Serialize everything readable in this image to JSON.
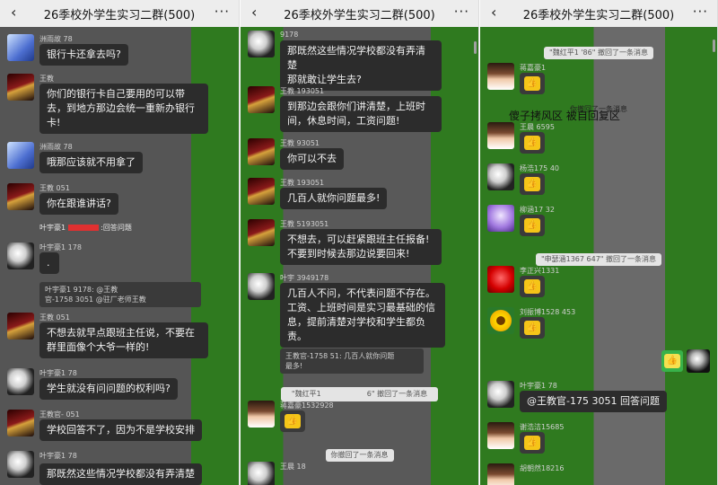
{
  "app": {
    "title": "26季校外学生实习二群(500)",
    "back_glyph": "‹",
    "more_glyph": "···",
    "thumbs_glyph": "👍"
  },
  "panel1": {
    "m1_name": "洲雨故",
    "m1_name_tail": "78",
    "m1_text": "银行卡还拿去吗?",
    "m2_name": "王教",
    "m2_name_tail": "",
    "m2_text_l1": "你们的银行卡自己要用的可以带",
    "m2_text_l2": "去，到地方那边会统一重新办银行",
    "m2_text_l3": "卡!",
    "m3_name": "洲雨故",
    "m3_name_tail": "78",
    "m3_text": "哦那应该就不用拿了",
    "m4_name": "王教",
    "m4_name_tail": "051",
    "m4_text": "你在跟谁讲话?",
    "m5_name": "叶宇豪1",
    "m5_tail": ":回答问题",
    "m6_name": "叶宇豪1",
    "m6_name_tail": "178",
    "m6_text": ".",
    "m6_quote_l1": "叶宇豪1          9178: @王教",
    "m6_quote_l2": "官-1758         3051 @驻厂老师王教",
    "m7_name": "王教",
    "m7_name_tail": "051",
    "m7_text_l1": "不想去就早点跟班主任说，不要在",
    "m7_text_l2": "群里面像个大爷一样的!",
    "m8_name": "叶宇豪1",
    "m8_name_tail": "78",
    "m8_text": "学生就没有问问题的权利吗?",
    "m9_name": "王教官-",
    "m9_name_tail": "051",
    "m9_text": "学校回答不了，因为不是学校安排",
    "m10_name": "叶宇豪1",
    "m10_name_tail": "78",
    "m10_text": "那既然这些情况学校都没有弄清楚"
  },
  "panel2": {
    "m1_name": "",
    "m1_name_tail": "9178",
    "m1_text_l1": "那既然这些情况学校都没有弄清楚",
    "m1_text_l2": "那就敢让学生去?",
    "m2_name": "王教",
    "m2_name_tail": "193051",
    "m2_text_l1": "到那边会跟你们讲清楚，上班时",
    "m2_text_l2": "间，休息时间，工资问题!",
    "m3_name": "王教",
    "m3_name_tail": "93051",
    "m3_text": "你可以不去",
    "m4_name": "王教",
    "m4_name_tail": "193051",
    "m4_text": "几百人就你问题最多!",
    "m5_name": "王教",
    "m5_name_tail": "5193051",
    "m5_text_l1": "不想去，可以赶紧跟班主任报备!",
    "m5_text_l2": "不要到时候去那边说要回来!",
    "m6_name": "叶宇",
    "m6_name_tail": "3949178",
    "m6_text_l1": "几百人不问，不代表问题不存在。",
    "m6_text_l2": "工资、上班时间是实习最基础的信",
    "m6_text_l3": "息，提前清楚对学校和学生都负",
    "m6_text_l4": "责。",
    "m6_quote_l1": "王教官-1758        51: 几百人就你问题",
    "m6_quote_l2": "最多!",
    "sys1_pre": "\"魏红平1",
    "sys1_post": "6\" 撤回了一条消息",
    "m7_name": "蒋嘉豪1532928",
    "m7_name_tail": "",
    "sys2": "你撤回了一条消息",
    "m8_name": "王晨",
    "m8_name_tail": "18"
  },
  "panel3": {
    "sys1": "\"魏红平1           '86\" 撤回了一条消息",
    "m1_name": "蒋嘉豪1",
    "m1_name_tail": "",
    "overlay_tip": "你撤回了一条消息",
    "overlay_text": "傻子拷风区            被自回复区",
    "m2_name": "王晨",
    "m2_name_tail": "6595",
    "m3_name": "杨浩175",
    "m3_name_tail": "40",
    "m4_name": "柳涵17",
    "m4_name_tail": "32",
    "sys2": "\"申瑟涵1367        647\" 撤回了一条消息",
    "m5_name": "李正兴1331",
    "m5_name_tail": "",
    "m6_name": "刘振博1528",
    "m6_name_tail": "453",
    "m7_name": "叶宇豪1",
    "m7_name_tail": "78",
    "m7_text_pre": "@王教官-175",
    "m7_text_post": "3051 回答问题",
    "m8_name": "谢浩洁15685",
    "m8_name_tail": "",
    "m9_name": "胡朝然18216",
    "m9_name_tail": ""
  }
}
